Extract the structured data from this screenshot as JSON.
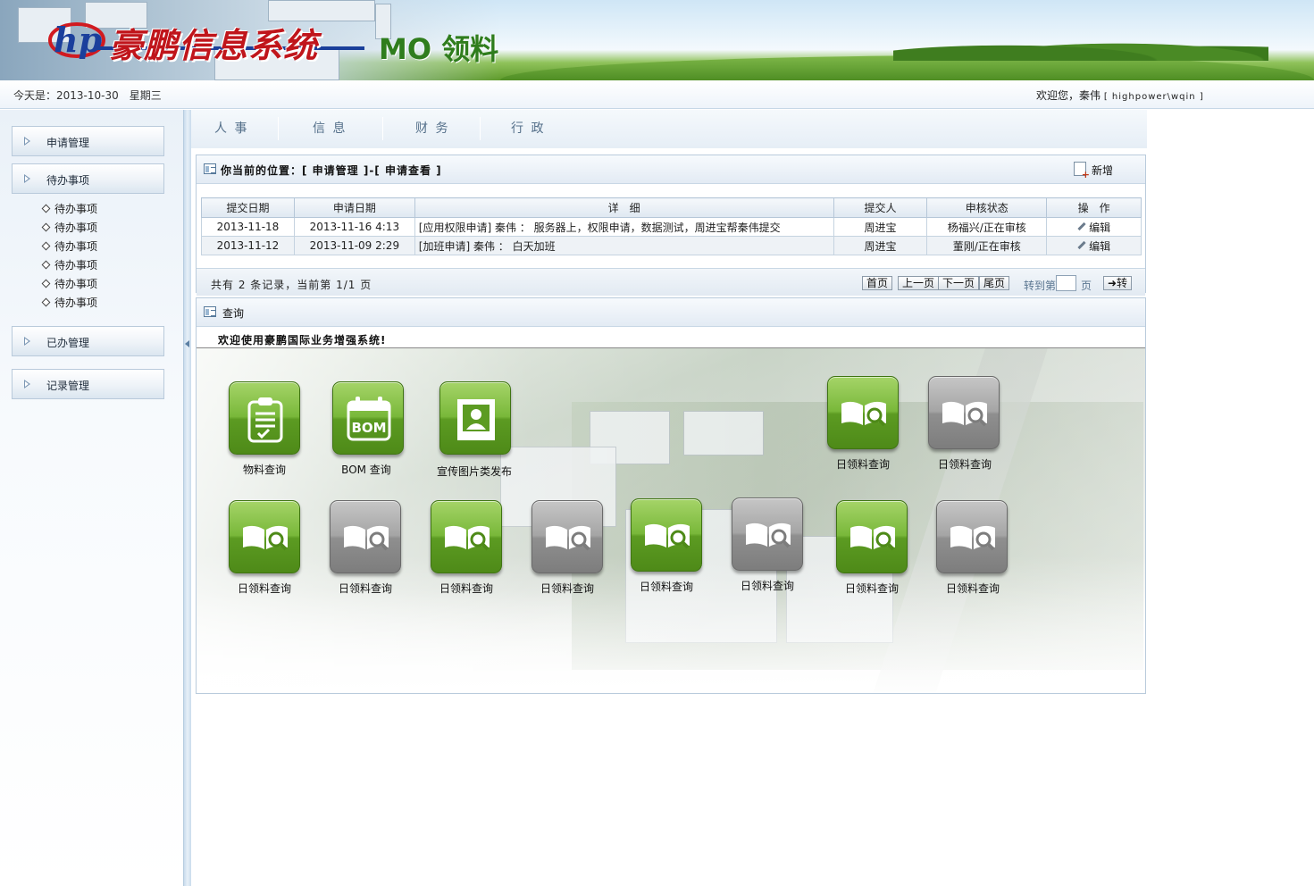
{
  "header": {
    "app_title": "豪鹏信息系统",
    "module_title": "MO 领料"
  },
  "infobar": {
    "date": "今天是：2013-10-30　星期三",
    "welcome": "欢迎您，秦伟",
    "user": "[ highpower\\wqin ]"
  },
  "sidebar": {
    "sections": [
      {
        "label": "申请管理"
      },
      {
        "label": "待办事项"
      },
      {
        "label": "已办管理"
      },
      {
        "label": "记录管理"
      }
    ],
    "sub_items": [
      "待办事项",
      "待办事项",
      "待办事项",
      "待办事项",
      "待办事项",
      "待办事项"
    ]
  },
  "tabs": [
    "人 事",
    "信 息",
    "财 务",
    "行 政"
  ],
  "list_panel": {
    "location": "你当前的位置：[ 申请管理 ]-[ 申请查看 ]",
    "add_label": "新增",
    "columns": [
      "提交日期",
      "申请日期",
      "详　细",
      "提交人",
      "申核状态",
      "操　作"
    ],
    "rows": [
      {
        "submit_date": "2013-11-18",
        "apply_date": "2013-11-16 4:13",
        "detail": "[应用权限申请] 秦伟 ： 服务器上，权限申请，数据测试，周进宝帮秦伟提交",
        "submitter": "周进宝",
        "status": "杨福兴/正在审核",
        "action": "编辑"
      },
      {
        "submit_date": "2013-11-12",
        "apply_date": "2013-11-09 2:29",
        "detail": "[加班申请] 秦伟 ： 白天加班",
        "submitter": "周进宝",
        "status": "董刚/正在审核",
        "action": "编辑"
      }
    ],
    "pager": {
      "info": "共有 2 条记录，当前第 1/1 页",
      "first": "首页",
      "prev": "上一页",
      "next": "下一页",
      "last": "尾页",
      "goto_label": "转到第",
      "goto_value": "",
      "page_unit": "页",
      "go": "➜转"
    }
  },
  "query_panel": {
    "title": "查询",
    "welcome": "欢迎使用豪鹏国际业务增强系统!",
    "tiles": [
      {
        "label": "物料查询",
        "color": "green",
        "icon": "clipboard-icon"
      },
      {
        "label": "BOM 查询",
        "color": "green",
        "icon": "bom-calendar-icon"
      },
      {
        "label": "宣传图片类发布",
        "color": "green",
        "icon": "portrait-icon"
      },
      {
        "label": "日领料查询",
        "color": "green",
        "icon": "book-search-icon"
      },
      {
        "label": "日领料查询",
        "color": "gray",
        "icon": "book-search-icon"
      },
      {
        "label": "日领料查询",
        "color": "green",
        "icon": "book-search-icon"
      },
      {
        "label": "日领料查询",
        "color": "gray",
        "icon": "book-search-icon"
      },
      {
        "label": "日领料查询",
        "color": "green",
        "icon": "book-search-icon"
      },
      {
        "label": "日领料查询",
        "color": "gray",
        "icon": "book-search-icon"
      },
      {
        "label": "日领料查询",
        "color": "green",
        "icon": "book-search-icon"
      },
      {
        "label": "日领料查询",
        "color": "gray",
        "icon": "book-search-icon"
      },
      {
        "label": "日领料查询",
        "color": "green",
        "icon": "book-search-icon"
      },
      {
        "label": "日领料查询",
        "color": "gray",
        "icon": "book-search-icon"
      }
    ]
  }
}
